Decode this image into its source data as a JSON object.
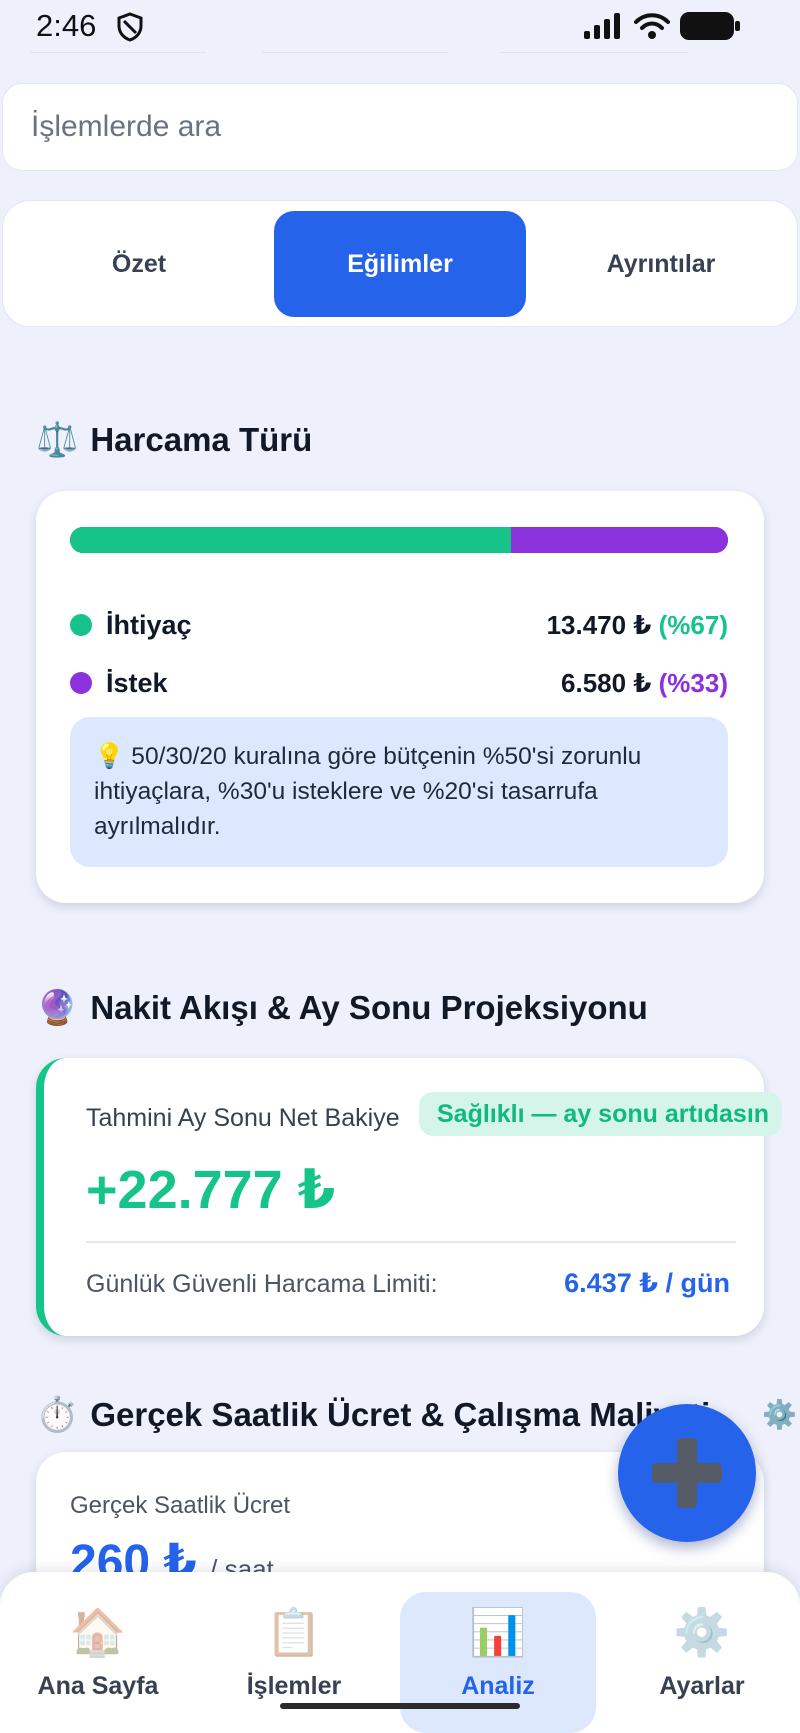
{
  "status_bar": {
    "time": "2:46"
  },
  "search": {
    "placeholder": "İşlemlerde ara"
  },
  "tabs": [
    {
      "label": "Özet",
      "active": false
    },
    {
      "label": "Eğilimler",
      "active": true
    },
    {
      "label": "Ayrıntılar",
      "active": false
    }
  ],
  "spending_type": {
    "emoji": "⚖️",
    "title": "Harcama Türü",
    "need_share": 67,
    "want_share": 33,
    "need": {
      "label": "İhtiyaç",
      "amount": "13.470 ₺",
      "percent": "(%67)"
    },
    "want": {
      "label": "İstek",
      "amount": "6.580 ₺",
      "percent": "(%33)"
    },
    "tip": "💡 50/30/20 kuralına göre bütçenin %50'si zorunlu ihtiyaçlara, %30'u isteklere ve %20'si tasarrufa ayrılmalıdır.",
    "colors": {
      "need": "#16c388",
      "want": "#8b32dd"
    }
  },
  "cash_flow": {
    "emoji": "🔮",
    "title": "Nakit Akışı & Ay Sonu Projeksiyonu",
    "projection_label": "Tahmini Ay Sonu Net Bakiye",
    "badge": "Sağlıklı — ay sonu artıdasın",
    "projection_value": "+22.777 ₺",
    "limit_label": "Günlük Güvenli Harcama Limiti:",
    "limit_value": "6.437 ₺ / gün"
  },
  "hourly_wage": {
    "emoji": "⏱️",
    "title": "Gerçek Saatlik Ücret & Çalışma Maliyeti",
    "label": "Gerçek Saatlik Ücret",
    "value": "260 ₺",
    "unit": "/ saat",
    "settings_emoji": "⚙️"
  },
  "fab": {
    "icon": "➕"
  },
  "bottom_nav": [
    {
      "icon": "🏠",
      "label": "Ana Sayfa",
      "active": false
    },
    {
      "icon": "📋",
      "label": "İşlemler",
      "active": false
    },
    {
      "icon": "📊",
      "label": "Analiz",
      "active": true
    },
    {
      "icon": "⚙️",
      "label": "Ayarlar",
      "active": false
    }
  ],
  "colors": {
    "accent": "#2563eb",
    "positive": "#16c388",
    "want": "#8b32dd",
    "background": "#eef1fb"
  }
}
